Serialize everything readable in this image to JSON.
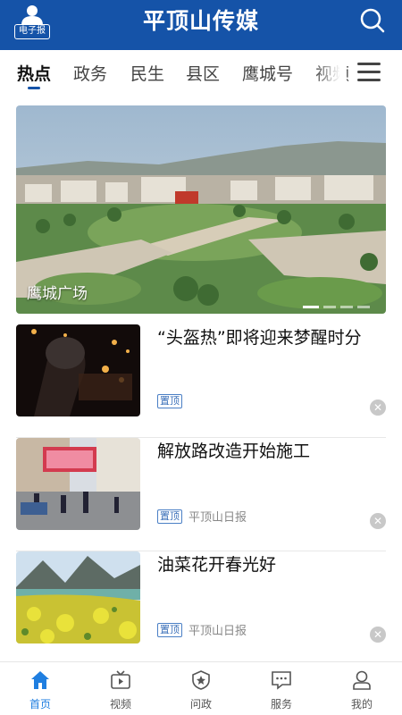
{
  "header": {
    "app_title": "平顶山传媒",
    "epaper_label": "电子报",
    "icons": {
      "epaper": "person-icon",
      "search": "search-icon"
    },
    "brand_color": "#1553a8"
  },
  "tabs": [
    {
      "label": "热点",
      "active": true
    },
    {
      "label": "政务"
    },
    {
      "label": "民生"
    },
    {
      "label": "县区"
    },
    {
      "label": "鹰城号"
    },
    {
      "label": "视频"
    }
  ],
  "menu_icon": "menu-icon",
  "banner": {
    "caption": "鹰城广场",
    "slide_count": 4,
    "active_slide": 1
  },
  "news": [
    {
      "title": "“头盔热”即将迎来梦醒时分",
      "badge": "置顶",
      "source": ""
    },
    {
      "title": "解放路改造开始施工",
      "badge": "置顶",
      "source": "平顶山日报"
    },
    {
      "title": "油菜花开春光好",
      "badge": "置顶",
      "source": "平顶山日报"
    }
  ],
  "bottom_nav": [
    {
      "label": "首页",
      "icon": "home-icon",
      "active": true
    },
    {
      "label": "视频",
      "icon": "tv-icon"
    },
    {
      "label": "问政",
      "icon": "shield-star-icon"
    },
    {
      "label": "服务",
      "icon": "chat-icon"
    },
    {
      "label": "我的",
      "icon": "user-icon"
    }
  ],
  "accent_color": "#1f7ee0"
}
